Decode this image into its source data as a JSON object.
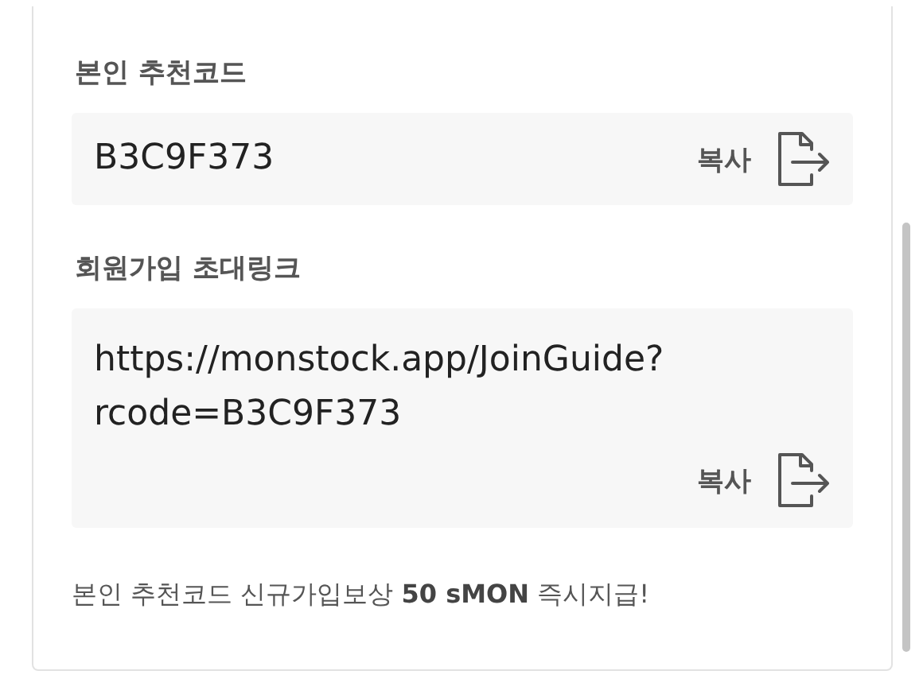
{
  "sections": [
    {
      "title": "본인 추천코드",
      "lines": [
        "B3C9F373"
      ],
      "copy_label": "복사",
      "kind": "inline"
    },
    {
      "title": "회원가입 초대링크",
      "lines": [
        "https://monstock.app/JoinGuide?",
        "rcode=B3C9F373"
      ],
      "copy_label": "복사",
      "kind": "block"
    }
  ],
  "footer": "본인 추천코드 신규가입보상 **50 sMON** 즉시지급!"
}
